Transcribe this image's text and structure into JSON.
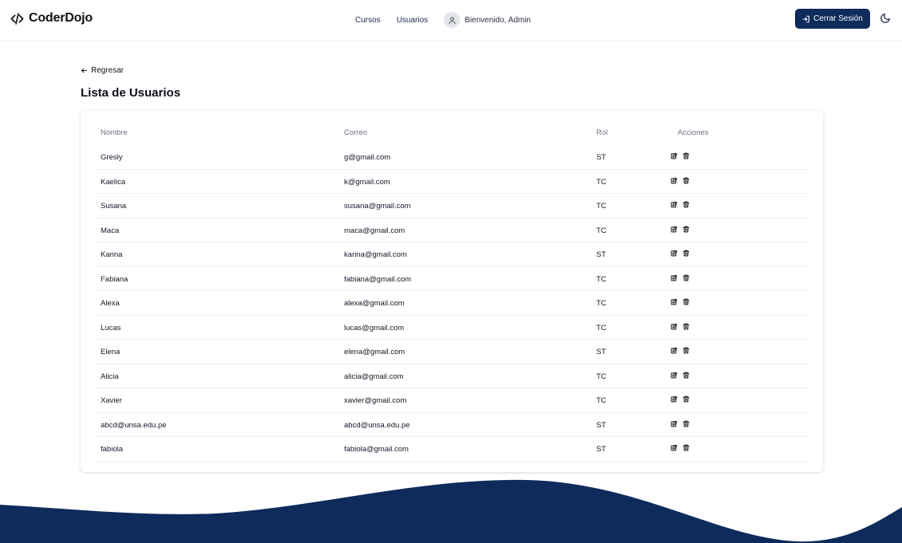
{
  "brand": {
    "name": "CoderDojo",
    "icon": "code-icon"
  },
  "nav": {
    "courses": "Cursos",
    "users": "Usuarios",
    "welcome": "Bienvenido, Admin"
  },
  "header": {
    "logout_label": "Cerrar Sesión"
  },
  "page": {
    "back_label": "Regresar",
    "title": "Lista de Usuarios"
  },
  "table": {
    "headers": {
      "name": "Nombre",
      "email": "Correo",
      "role": "Rol",
      "actions": "Acciones"
    },
    "rows": [
      {
        "name": "Gresly",
        "email": "g@gmail.com",
        "role": "ST"
      },
      {
        "name": "Kaelica",
        "email": "k@gmail.com",
        "role": "TC"
      },
      {
        "name": "Susana",
        "email": "susana@gmail.com",
        "role": "TC"
      },
      {
        "name": "Maca",
        "email": "maca@gmail.com",
        "role": "TC"
      },
      {
        "name": "Karina",
        "email": "karina@gmail.com",
        "role": "ST"
      },
      {
        "name": "Fabiana",
        "email": "fabiana@gmail.com",
        "role": "TC"
      },
      {
        "name": "Alexa",
        "email": "alexa@gmail.com",
        "role": "TC"
      },
      {
        "name": "Lucas",
        "email": "lucas@gmail.com",
        "role": "TC"
      },
      {
        "name": "Elena",
        "email": "elena@gmail.com",
        "role": "ST"
      },
      {
        "name": "Alicia",
        "email": "alicia@gmail.com",
        "role": "TC"
      },
      {
        "name": "Xavier",
        "email": "xavier@gmail.com",
        "role": "TC"
      },
      {
        "name": "abcd@unsa.edu.pe",
        "email": "abcd@unsa.edu.pe",
        "role": "ST"
      },
      {
        "name": "fabiola",
        "email": "fabiola@gmail.com",
        "role": "ST"
      }
    ]
  },
  "colors": {
    "primary": "#0e2b5c",
    "wave": "#0e2b5c"
  }
}
